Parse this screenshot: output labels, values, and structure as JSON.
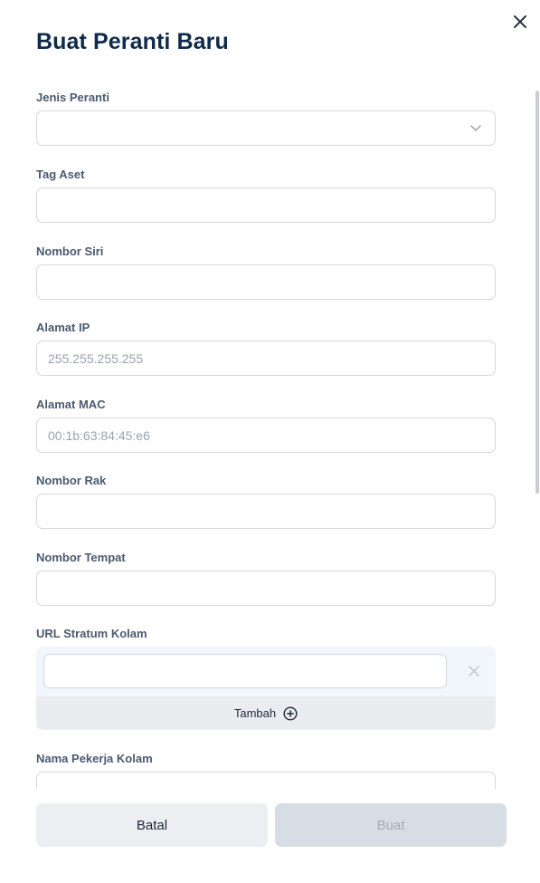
{
  "dialog": {
    "title": "Buat Peranti Baru"
  },
  "fields": {
    "device_type": {
      "label": "Jenis Peranti",
      "value": ""
    },
    "asset_tag": {
      "label": "Tag Aset",
      "value": "",
      "placeholder": ""
    },
    "serial_number": {
      "label": "Nombor Siri",
      "value": "",
      "placeholder": ""
    },
    "ip_address": {
      "label": "Alamat IP",
      "value": "",
      "placeholder": "255.255.255.255"
    },
    "mac_address": {
      "label": "Alamat MAC",
      "value": "",
      "placeholder": "00:1b:63:84:45:e6"
    },
    "rack_number": {
      "label": "Nombor Rak",
      "value": "",
      "placeholder": ""
    },
    "slot_number": {
      "label": "Nombor Tempat",
      "value": "",
      "placeholder": ""
    },
    "pool_stratum_url": {
      "label": "URL Stratum Kolam",
      "value": "",
      "add_label": "Tambah"
    },
    "pool_worker_name": {
      "label": "Nama Pekerja Kolam",
      "value": "",
      "placeholder": ""
    }
  },
  "actions": {
    "cancel_label": "Batal",
    "create_label": "Buat"
  },
  "icons": {
    "close": "close-icon",
    "dropdown": "chevron-down-icon",
    "remove": "close-icon",
    "add": "plus-circle-icon"
  },
  "colors": {
    "title": "#0f2a4a",
    "label": "#4a5a6e",
    "border": "#d4d8de",
    "url_row_bg": "#f1f5fc",
    "add_bg": "#eaecef",
    "cancel_bg": "#eceef1",
    "create_disabled_bg": "#d6dde4"
  }
}
